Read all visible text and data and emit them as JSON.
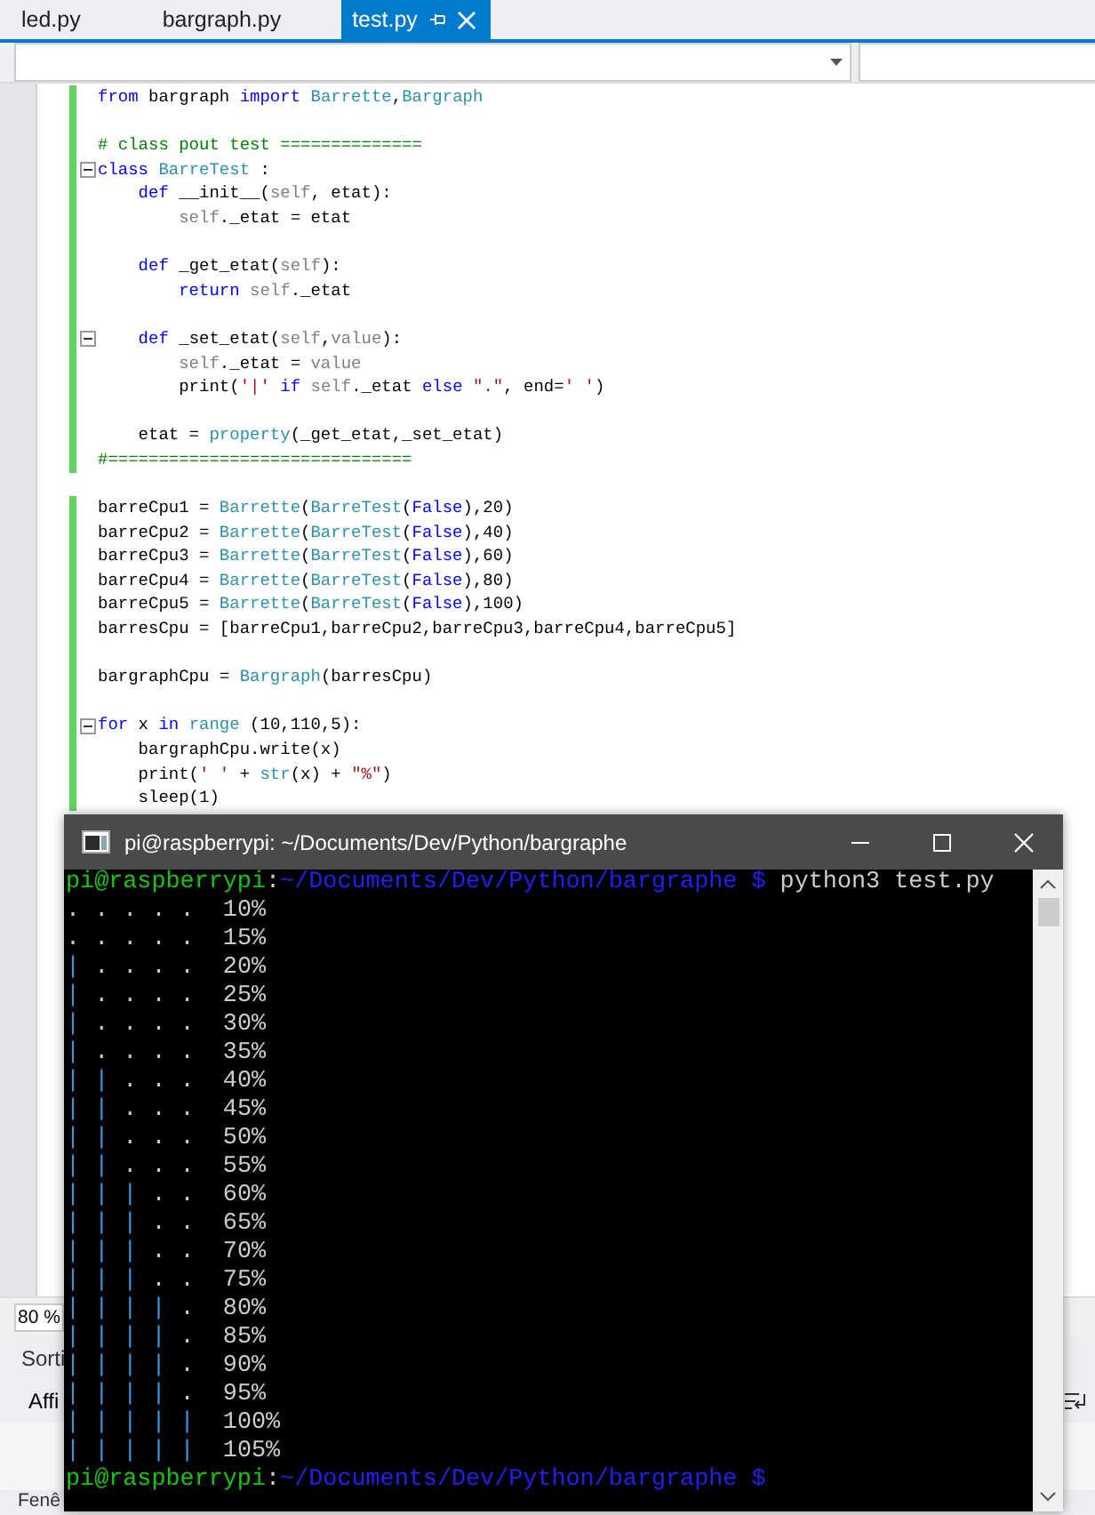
{
  "editor_tabs": [
    {
      "label": "led.py",
      "selected": false,
      "pinned": false
    },
    {
      "label": "bargraph.py",
      "selected": false,
      "pinned": false
    },
    {
      "label": "test.py",
      "selected": true,
      "pinned": true
    }
  ],
  "code_lines": [
    {
      "changed": true,
      "fold": false,
      "tokens": [
        {
          "t": "from",
          "kind": "kw"
        },
        {
          "t": " bargraph ",
          "kind": "plain"
        },
        {
          "t": "import",
          "kind": "kw"
        },
        {
          "t": " Barrette",
          "kind": "cls"
        },
        {
          "t": ",",
          "kind": "plain"
        },
        {
          "t": "Bargraph",
          "kind": "cls"
        }
      ]
    },
    {
      "changed": true,
      "fold": false
    },
    {
      "changed": true,
      "fold": false,
      "tokens": [
        {
          "t": "# class pout test ==============",
          "kind": "cm"
        }
      ]
    },
    {
      "changed": true,
      "fold": true,
      "tokens": [
        {
          "t": "class",
          "kind": "kw"
        },
        {
          "t": " BarreTest",
          "kind": "cls"
        },
        {
          "t": " :",
          "kind": "plain"
        }
      ]
    },
    {
      "changed": true,
      "fold": false,
      "tokens": [
        {
          "t": "    def",
          "kind": "kw"
        },
        {
          "t": " __init__(",
          "kind": "plain"
        },
        {
          "t": "self",
          "kind": "self"
        },
        {
          "t": ", etat):",
          "kind": "plain"
        }
      ]
    },
    {
      "changed": true,
      "fold": false,
      "tokens": [
        {
          "t": "        self",
          "kind": "self"
        },
        {
          "t": "._etat = etat",
          "kind": "plain"
        }
      ]
    },
    {
      "changed": true,
      "fold": false
    },
    {
      "changed": true,
      "fold": false,
      "tokens": [
        {
          "t": "    def",
          "kind": "kw"
        },
        {
          "t": " _get_etat(",
          "kind": "plain"
        },
        {
          "t": "self",
          "kind": "self"
        },
        {
          "t": "):",
          "kind": "plain"
        }
      ]
    },
    {
      "changed": true,
      "fold": false,
      "tokens": [
        {
          "t": "        return",
          "kind": "kw"
        },
        {
          "t": " self",
          "kind": "self"
        },
        {
          "t": "._etat",
          "kind": "plain"
        }
      ]
    },
    {
      "changed": true,
      "fold": false
    },
    {
      "changed": true,
      "fold": true,
      "tokens": [
        {
          "t": "    def",
          "kind": "kw"
        },
        {
          "t": " _set_etat(",
          "kind": "plain"
        },
        {
          "t": "self",
          "kind": "self"
        },
        {
          "t": ",",
          "kind": "plain"
        },
        {
          "t": "value",
          "kind": "self"
        },
        {
          "t": "):",
          "kind": "plain"
        }
      ]
    },
    {
      "changed": true,
      "fold": false,
      "tokens": [
        {
          "t": "        self",
          "kind": "self"
        },
        {
          "t": "._etat = ",
          "kind": "plain"
        },
        {
          "t": "value",
          "kind": "self"
        }
      ]
    },
    {
      "changed": true,
      "fold": false,
      "tokens": [
        {
          "t": "        print(",
          "kind": "plain"
        },
        {
          "t": "'|'",
          "kind": "str"
        },
        {
          "t": " if",
          "kind": "kw"
        },
        {
          "t": " self",
          "kind": "self"
        },
        {
          "t": "._etat ",
          "kind": "plain"
        },
        {
          "t": "else",
          "kind": "kw"
        },
        {
          "t": " \".\"",
          "kind": "str"
        },
        {
          "t": ", end=",
          "kind": "plain"
        },
        {
          "t": "' '",
          "kind": "str"
        },
        {
          "t": ")",
          "kind": "plain"
        }
      ]
    },
    {
      "changed": true,
      "fold": false
    },
    {
      "changed": true,
      "fold": false,
      "tokens": [
        {
          "t": "    etat = ",
          "kind": "plain"
        },
        {
          "t": "property",
          "kind": "builtin"
        },
        {
          "t": "(_get_etat,_set_etat)",
          "kind": "plain"
        }
      ]
    },
    {
      "changed": true,
      "fold": false,
      "tokens": [
        {
          "t": "#==============================",
          "kind": "cm"
        }
      ]
    },
    {
      "changed": false,
      "fold": false
    },
    {
      "changed": true,
      "fold": false,
      "tokens": [
        {
          "t": "barreCpu1 = ",
          "kind": "plain"
        },
        {
          "t": "Barrette",
          "kind": "cls"
        },
        {
          "t": "(",
          "kind": "plain"
        },
        {
          "t": "BarreTest",
          "kind": "cls"
        },
        {
          "t": "(",
          "kind": "plain"
        },
        {
          "t": "False",
          "kind": "kw"
        },
        {
          "t": "),20)",
          "kind": "plain"
        }
      ]
    },
    {
      "changed": true,
      "fold": false,
      "tokens": [
        {
          "t": "barreCpu2 = ",
          "kind": "plain"
        },
        {
          "t": "Barrette",
          "kind": "cls"
        },
        {
          "t": "(",
          "kind": "plain"
        },
        {
          "t": "BarreTest",
          "kind": "cls"
        },
        {
          "t": "(",
          "kind": "plain"
        },
        {
          "t": "False",
          "kind": "kw"
        },
        {
          "t": "),40)",
          "kind": "plain"
        }
      ]
    },
    {
      "changed": true,
      "fold": false,
      "tokens": [
        {
          "t": "barreCpu3 = ",
          "kind": "plain"
        },
        {
          "t": "Barrette",
          "kind": "cls"
        },
        {
          "t": "(",
          "kind": "plain"
        },
        {
          "t": "BarreTest",
          "kind": "cls"
        },
        {
          "t": "(",
          "kind": "plain"
        },
        {
          "t": "False",
          "kind": "kw"
        },
        {
          "t": "),60)",
          "kind": "plain"
        }
      ]
    },
    {
      "changed": true,
      "fold": false,
      "tokens": [
        {
          "t": "barreCpu4 = ",
          "kind": "plain"
        },
        {
          "t": "Barrette",
          "kind": "cls"
        },
        {
          "t": "(",
          "kind": "plain"
        },
        {
          "t": "BarreTest",
          "kind": "cls"
        },
        {
          "t": "(",
          "kind": "plain"
        },
        {
          "t": "False",
          "kind": "kw"
        },
        {
          "t": "),80)",
          "kind": "plain"
        }
      ]
    },
    {
      "changed": true,
      "fold": false,
      "tokens": [
        {
          "t": "barreCpu5 = ",
          "kind": "plain"
        },
        {
          "t": "Barrette",
          "kind": "cls"
        },
        {
          "t": "(",
          "kind": "plain"
        },
        {
          "t": "BarreTest",
          "kind": "cls"
        },
        {
          "t": "(",
          "kind": "plain"
        },
        {
          "t": "False",
          "kind": "kw"
        },
        {
          "t": "),100)",
          "kind": "plain"
        }
      ]
    },
    {
      "changed": true,
      "fold": false,
      "tokens": [
        {
          "t": "barresCpu = [barreCpu1,barreCpu2,barreCpu3,barreCpu4,barreCpu5]",
          "kind": "plain"
        }
      ]
    },
    {
      "changed": true,
      "fold": false
    },
    {
      "changed": true,
      "fold": false,
      "tokens": [
        {
          "t": "bargraphCpu = ",
          "kind": "plain"
        },
        {
          "t": "Bargraph",
          "kind": "cls"
        },
        {
          "t": "(barresCpu)",
          "kind": "plain"
        }
      ]
    },
    {
      "changed": true,
      "fold": false
    },
    {
      "changed": true,
      "fold": true,
      "tokens": [
        {
          "t": "for",
          "kind": "kw"
        },
        {
          "t": " x ",
          "kind": "plain"
        },
        {
          "t": "in",
          "kind": "kw"
        },
        {
          "t": " range",
          "kind": "builtin"
        },
        {
          "t": " (10,110,5):",
          "kind": "plain"
        }
      ]
    },
    {
      "changed": true,
      "fold": false,
      "tokens": [
        {
          "t": "    bargraphCpu.write(x)",
          "kind": "plain"
        }
      ]
    },
    {
      "changed": true,
      "fold": false,
      "tokens": [
        {
          "t": "    print(",
          "kind": "plain"
        },
        {
          "t": "' '",
          "kind": "str"
        },
        {
          "t": " + ",
          "kind": "plain"
        },
        {
          "t": "str",
          "kind": "builtin"
        },
        {
          "t": "(x) + ",
          "kind": "plain"
        },
        {
          "t": "\"%\"",
          "kind": "str"
        },
        {
          "t": ")",
          "kind": "plain"
        }
      ]
    },
    {
      "changed": true,
      "fold": false,
      "tokens": [
        {
          "t": "    sleep(1)",
          "kind": "plain"
        }
      ]
    }
  ],
  "zoom_level": "80 %",
  "output_panel": {
    "title": "Sorti",
    "show_label": "Affi"
  },
  "bottom_tab": "Fenê",
  "terminal": {
    "title": "pi@raspberrypi: ~/Documents/Dev/Python/bargraphe",
    "lines": [
      {
        "kind": "prompt",
        "parts": [
          {
            "t": "pi@raspberrypi",
            "kind": "user"
          },
          {
            "t": ":",
            "kind": "sep"
          },
          {
            "t": "~/Documents/Dev/Python/bargraphe $",
            "kind": "path"
          },
          {
            "t": " python3 test.py",
            "kind": "cmd"
          }
        ]
      },
      {
        "kind": "output",
        "off": ". . . . .",
        "value": "10%"
      },
      {
        "kind": "output",
        "off": ". . . . .",
        "value": "15%"
      },
      {
        "kind": "output",
        "on": "|",
        "off": ". . . .",
        "value": "20%"
      },
      {
        "kind": "output",
        "on": "|",
        "off": ". . . .",
        "value": "25%"
      },
      {
        "kind": "output",
        "on": "|",
        "off": ". . . .",
        "value": "30%"
      },
      {
        "kind": "output",
        "on": "|",
        "off": ". . . .",
        "value": "35%"
      },
      {
        "kind": "output",
        "on": "| |",
        "off": ". . .",
        "value": "40%"
      },
      {
        "kind": "output",
        "on": "| |",
        "off": ". . .",
        "value": "45%"
      },
      {
        "kind": "output",
        "on": "| |",
        "off": ". . .",
        "value": "50%"
      },
      {
        "kind": "output",
        "on": "| |",
        "off": ". . .",
        "value": "55%"
      },
      {
        "kind": "output",
        "on": "| | |",
        "off": ". .",
        "value": "60%"
      },
      {
        "kind": "output",
        "on": "| | |",
        "off": ". .",
        "value": "65%"
      },
      {
        "kind": "output",
        "on": "| | |",
        "off": ". .",
        "value": "70%"
      },
      {
        "kind": "output",
        "on": "| | |",
        "off": ". .",
        "value": "75%"
      },
      {
        "kind": "output",
        "on": "| | | |",
        "off": ".",
        "value": "80%"
      },
      {
        "kind": "output",
        "on": "| | | |",
        "off": ".",
        "value": "85%"
      },
      {
        "kind": "output",
        "on": "| | | |",
        "off": ".",
        "value": "90%"
      },
      {
        "kind": "output",
        "on": "| | | |",
        "off": ".",
        "value": "95%"
      },
      {
        "kind": "output",
        "on": "| | | | |",
        "value": "100%"
      },
      {
        "kind": "output",
        "on": "| | | | |",
        "value": "105%"
      },
      {
        "kind": "prompt",
        "parts": [
          {
            "t": "pi@raspberrypi",
            "kind": "user"
          },
          {
            "t": ":",
            "kind": "sep"
          },
          {
            "t": "~/Documents/Dev/Python/bargraphe $",
            "kind": "path"
          }
        ]
      }
    ]
  }
}
